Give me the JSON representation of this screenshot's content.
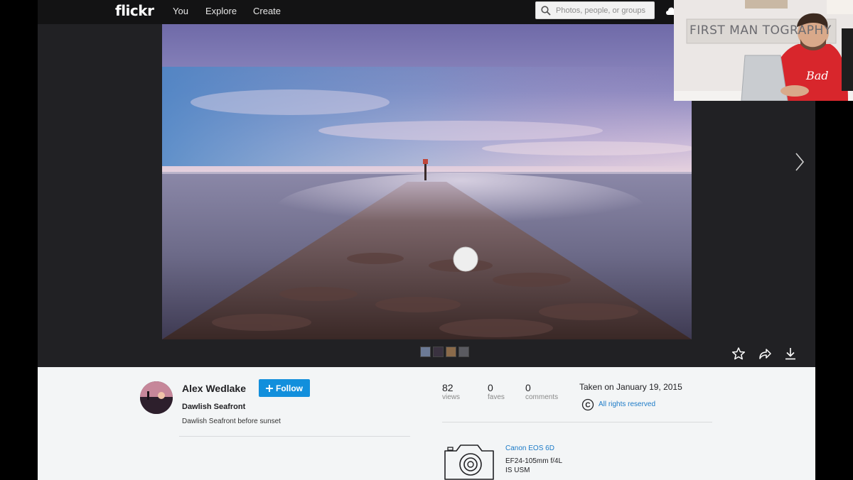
{
  "nav": {
    "logo": "flickr",
    "items": [
      "You",
      "Explore",
      "Create"
    ],
    "search_placeholder": "Photos, people, or groups"
  },
  "owner": {
    "name": "Alex Wedlake",
    "follow_label": "Follow"
  },
  "photo": {
    "title": "Dawlish Seafront",
    "description": "Dawlish Seafront before sunset"
  },
  "stats": [
    {
      "value": "82",
      "label": "views"
    },
    {
      "value": "0",
      "label": "faves"
    },
    {
      "value": "0",
      "label": "comments"
    }
  ],
  "taken": "Taken on January 19, 2015",
  "rights": "All rights reserved",
  "camera": {
    "name": "Canon EOS 6D",
    "lens": "EF24-105mm f/4L IS USM"
  },
  "webcam": {
    "sign_text": "FIRST MAN    TOGRAPHY",
    "shirt_text": "Bad"
  },
  "colors": {
    "follow_button": "#128fdc",
    "link": "#1b7ac7",
    "nav_bg": "#131314",
    "stage_bg": "#212124"
  }
}
